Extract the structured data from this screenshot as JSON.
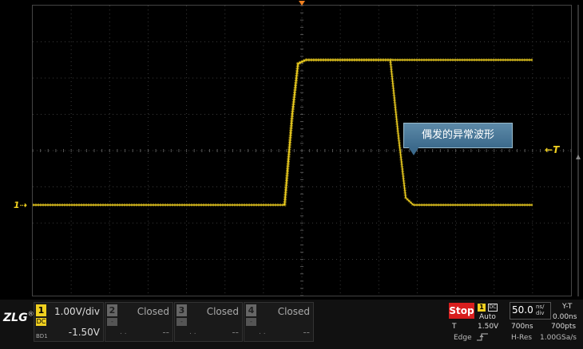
{
  "screen": {
    "trace_color": "#f0d020",
    "grid_color": "#3a3a3a",
    "channel_marker": "1",
    "trigger_marker": "T",
    "callout_text": "偶发的异常波形"
  },
  "chart_data": {
    "type": "line",
    "x_divs": 14,
    "y_divs": 8,
    "series": [
      {
        "values_div": [
          [
            0,
            -1.5
          ],
          [
            6.55,
            -1.5
          ],
          [
            6.75,
            1.0
          ],
          [
            6.9,
            2.4
          ],
          [
            7.1,
            2.5
          ],
          [
            9.3,
            2.5
          ],
          [
            9.5,
            0.5
          ],
          [
            9.7,
            -1.3
          ],
          [
            9.9,
            -1.5
          ],
          [
            13.0,
            -1.5
          ]
        ]
      },
      {
        "values_div": [
          [
            6.55,
            -1.5
          ],
          [
            6.75,
            1.0
          ],
          [
            6.9,
            2.4
          ],
          [
            7.1,
            2.5
          ],
          [
            13.0,
            2.5
          ]
        ]
      }
    ]
  },
  "logo": {
    "text": "ZLG",
    "mark": "®"
  },
  "channels": [
    {
      "num": "1",
      "coupling": "DC",
      "bw": "BD1",
      "scale": "1.00V/div",
      "offset": "-1.50V",
      "active": true
    },
    {
      "num": "2",
      "coupling": "-",
      "bw": "",
      "scale": "Closed",
      "offset": "--",
      "dots": ". .",
      "active": false
    },
    {
      "num": "3",
      "coupling": "-",
      "bw": "",
      "scale": "Closed",
      "offset": "--",
      "dots": ". .",
      "active": false
    },
    {
      "num": "4",
      "coupling": "-",
      "bw": "",
      "scale": "Closed",
      "offset": "--",
      "dots": ". .",
      "active": false
    }
  ],
  "trigger": {
    "state": "Stop",
    "source": "1",
    "coupling": "DC",
    "mode": "Auto",
    "label": "T",
    "level": "1.50V",
    "type": "Edge"
  },
  "horizontal": {
    "timebase": "50.0",
    "timebase_unit_top": "ns/",
    "timebase_unit_bottom": "div",
    "window": "700ns",
    "acq_mode": "H-Res",
    "display_mode": "Y-T",
    "delay": "0.00ns",
    "points": "700pts",
    "sample_rate": "1.00GSa/s"
  }
}
